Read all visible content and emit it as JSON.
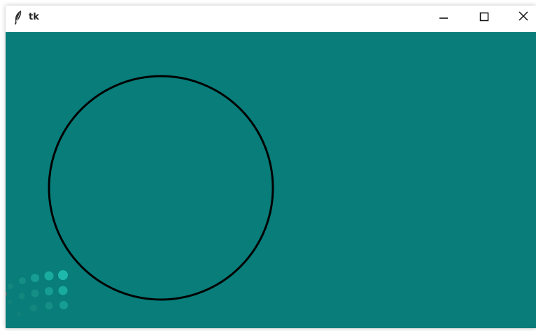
{
  "window": {
    "title": "tk",
    "icon": "tk-feather-icon",
    "controls": [
      "minimize-icon",
      "maximize-icon",
      "close-icon"
    ]
  },
  "canvas": {
    "background_color": "#087d7a",
    "shape": "circle",
    "outline_color": "#000000"
  }
}
